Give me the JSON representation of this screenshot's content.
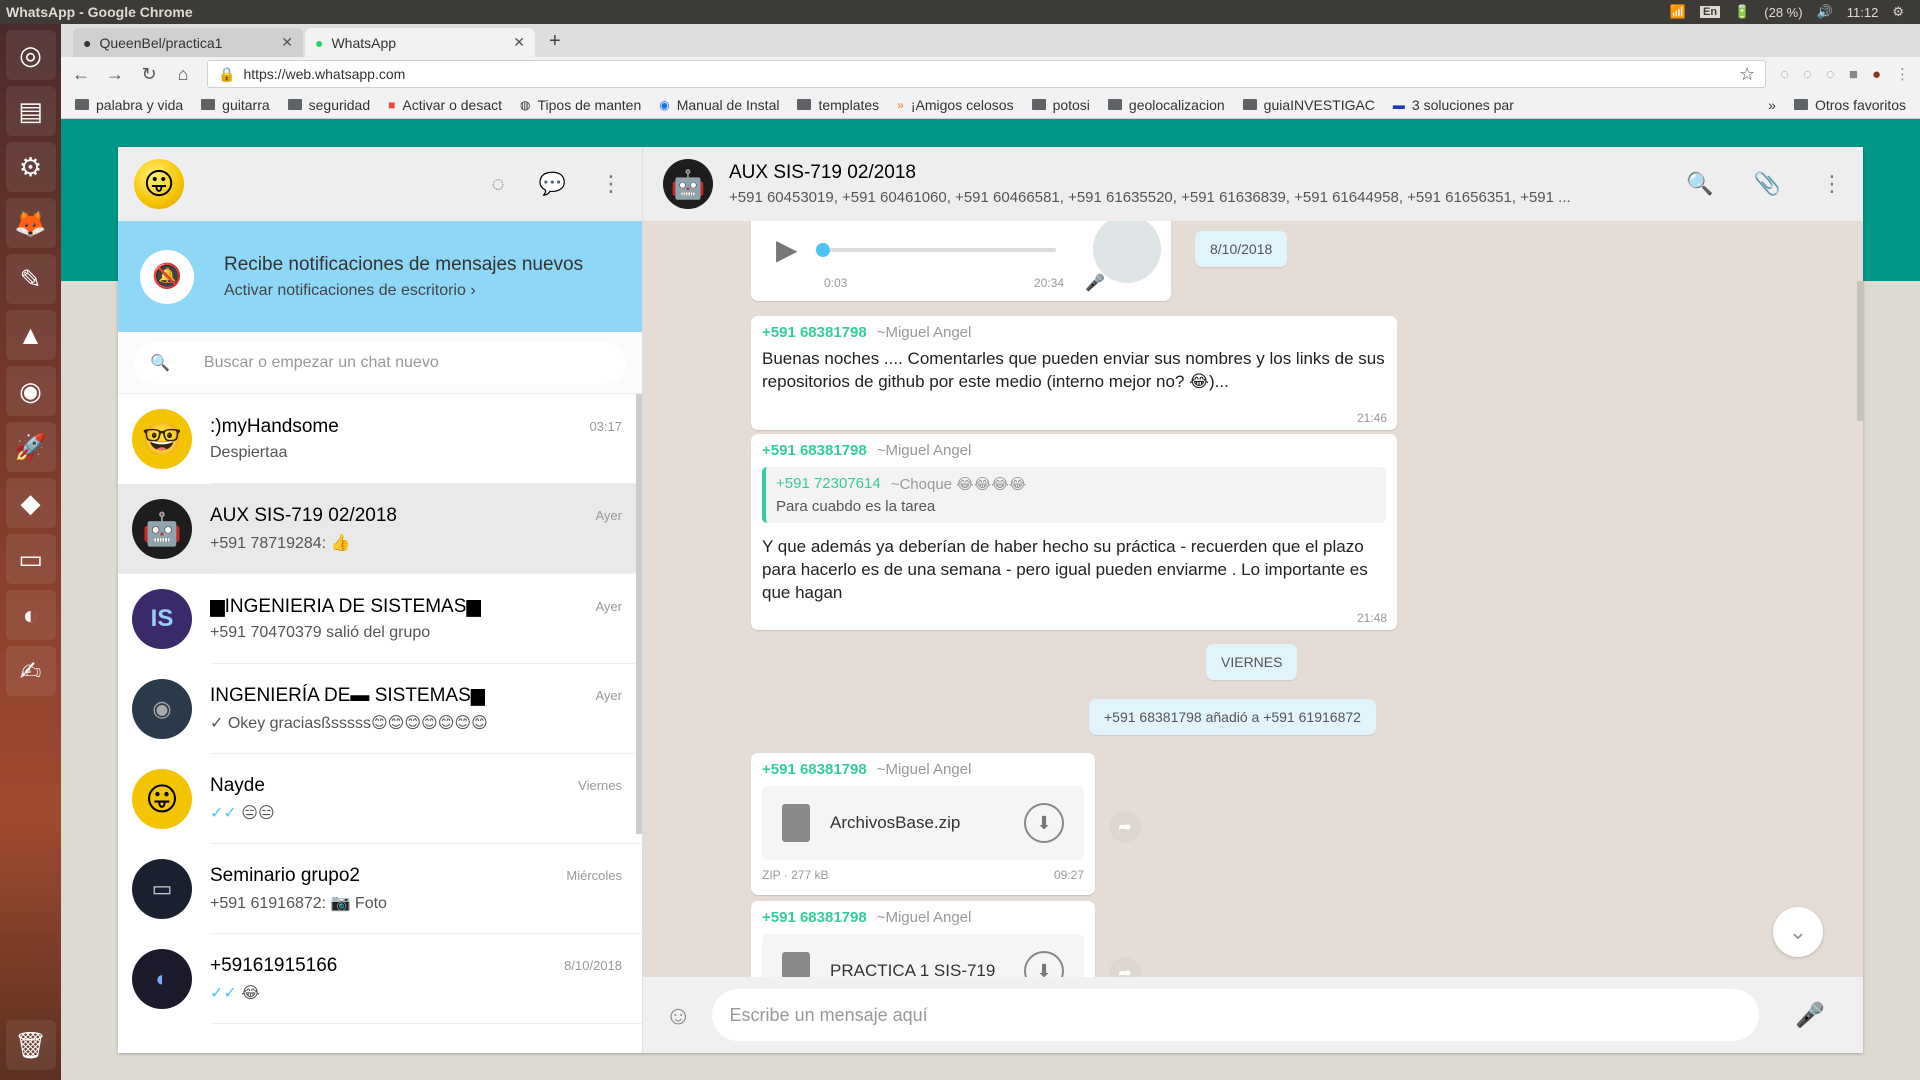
{
  "os": {
    "window_title": "WhatsApp - Google Chrome",
    "keyboard": "En",
    "battery": "(28 %)",
    "clock": "11:12"
  },
  "browser": {
    "tabs": [
      {
        "label": "QueenBel/practica1"
      },
      {
        "label": "WhatsApp"
      }
    ],
    "url": "https://web.whatsapp.com",
    "bookmarks": [
      "palabra y vida",
      "guitarra",
      "seguridad",
      "Activar o desact",
      "Tipos de manten",
      "Manual de Instal",
      "templates",
      "¡Amigos celosos",
      "potosi",
      "geolocalizacion",
      "guiaINVESTIGAC",
      "3 soluciones par"
    ],
    "bookmarks_more": "»",
    "other_bookmarks": "Otros favoritos"
  },
  "notification": {
    "title": "Recibe notificaciones de mensajes nuevos",
    "subtitle": "Activar notificaciones de escritorio ›"
  },
  "search": {
    "placeholder": "Buscar o empezar un chat nuevo"
  },
  "chats": [
    {
      "name": ":)myHandsome",
      "time": "03:17",
      "preview": "Despiertaa"
    },
    {
      "name": "AUX SIS-719 02/2018",
      "time": "Ayer",
      "preview": "+591 78719284: 👍"
    },
    {
      "name": "▆INGENIERIA DE SISTEMAS▆",
      "time": "Ayer",
      "preview": "+591 70470379 salió del grupo"
    },
    {
      "name": "INGENIERÍA DE▬ SISTEMAS▆",
      "time": "Ayer",
      "preview": "✓ Okey graciasßsssss😊😊😊😊😊😊😊"
    },
    {
      "name": "Nayde",
      "time": "Viernes",
      "preview": "😑😑"
    },
    {
      "name": "Seminario grupo2",
      "time": "Miércoles",
      "preview": "+591 61916872: 📷 Foto"
    },
    {
      "name": "+59161915166",
      "time": "8/10/2018",
      "preview": "😂"
    }
  ],
  "conversation": {
    "name": "AUX SIS-719 02/2018",
    "members": "+591 60453019, +591 60461060, +591 60466581, +591 61635520, +591 61636839, +591 61644958, +591 61656351, +591 ...",
    "audio": {
      "elapsed": "0:03",
      "duration": "20:34"
    },
    "date_pill": "8/10/2018",
    "msg1": {
      "number": "+591 68381798",
      "alias": "~Miguel Angel",
      "text": "Buenas noches .... Comentarles que pueden enviar sus nombres y los links de sus repositorios de github por este medio (interno mejor no? 😂)...",
      "time": "21:46"
    },
    "msg2": {
      "number": "+591 68381798",
      "alias": "~Miguel Angel",
      "quote_number": "+591 72307614",
      "quote_alias": "~Choque 😂😂😂😂",
      "quote_text": "Para cuabdo es la tarea",
      "text": "Y que además ya deberían de haber hecho su práctica - recuerden que el plazo para hacerlo es de una semana - pero igual pueden enviarme . Lo importante es que hagan",
      "time": "21:48"
    },
    "day_pill": "VIERNES",
    "system_pill": "+591 68381798 añadió a +591 61916872",
    "msg3": {
      "number": "+591 68381798",
      "alias": "~Miguel Angel",
      "file_name": "ArchivosBase.zip",
      "file_meta": "ZIP · 277 kB",
      "time": "09:27"
    },
    "msg4": {
      "number": "+591 68381798",
      "alias": "~Miguel Angel",
      "file_name": "PRACTICA 1 SIS-719"
    },
    "composer_placeholder": "Escribe un mensaje aquí"
  }
}
